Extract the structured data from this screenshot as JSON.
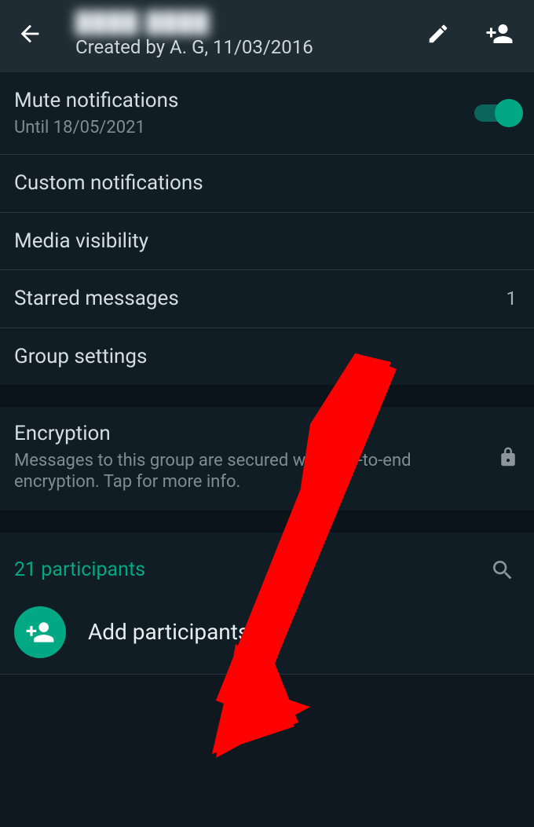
{
  "header": {
    "title": "████ ████",
    "subtitle": "Created by A. G, 11/03/2016"
  },
  "mute": {
    "title": "Mute notifications",
    "until": "Until 18/05/2021",
    "enabled": true
  },
  "custom_notifications": {
    "title": "Custom notifications"
  },
  "media_visibility": {
    "title": "Media visibility"
  },
  "starred": {
    "title": "Starred messages",
    "count": "1"
  },
  "group_settings": {
    "title": "Group settings"
  },
  "encryption": {
    "title": "Encryption",
    "desc": "Messages to this group are secured with end-to-end encryption. Tap for more info."
  },
  "participants": {
    "count_label": "21 participants",
    "add_label": "Add participants"
  }
}
